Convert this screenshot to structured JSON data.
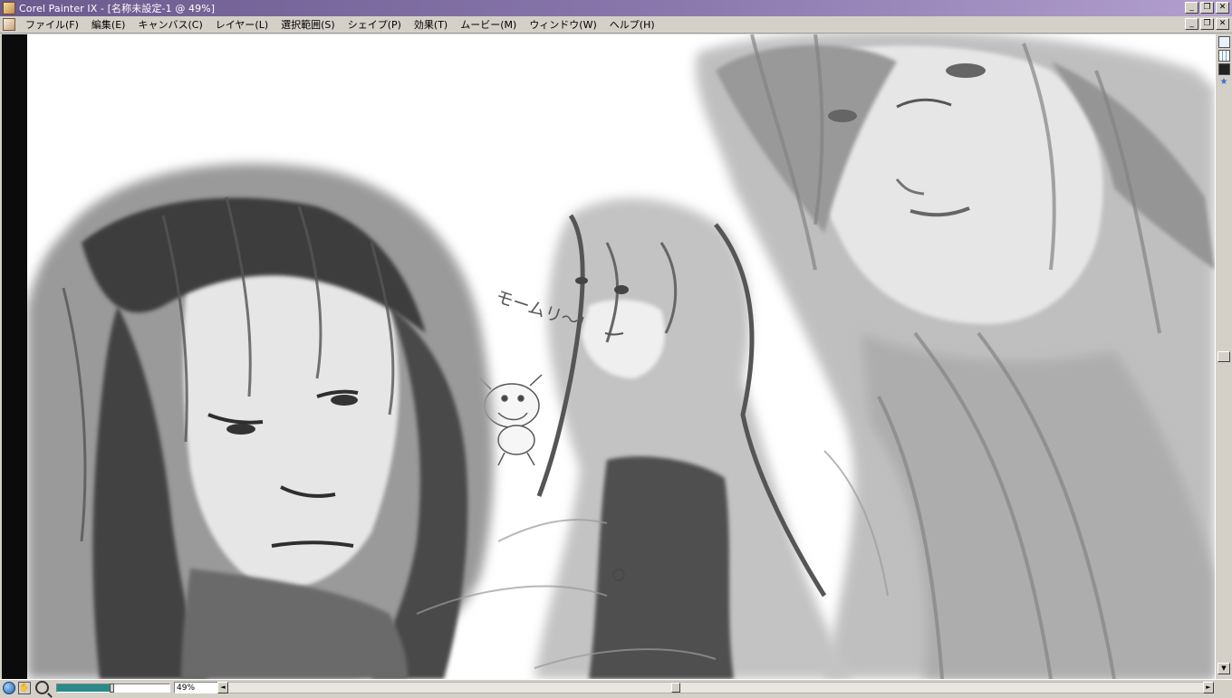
{
  "window": {
    "title": "Corel Painter IX - [名称未設定-1 @ 49%]",
    "minimize": "_",
    "restore": "❐",
    "close": "✕"
  },
  "menu": {
    "items": [
      {
        "label": "ファイル(F)"
      },
      {
        "label": "編集(E)"
      },
      {
        "label": "キャンバス(C)"
      },
      {
        "label": "レイヤー(L)"
      },
      {
        "label": "選択範囲(S)"
      },
      {
        "label": "シェイプ(P)"
      },
      {
        "label": "効果(T)"
      },
      {
        "label": "ムービー(M)"
      },
      {
        "label": "ウィンドウ(W)"
      },
      {
        "label": "ヘルプ(H)"
      }
    ]
  },
  "canvas": {
    "sketch_text": "モームリ～!"
  },
  "statusbar": {
    "zoom_text": "49%",
    "zoom_level": 0.49,
    "left_arrow": "◄",
    "right_arrow": "►"
  },
  "icons": {
    "app": "painter-icon",
    "document": "document-icon",
    "globe": "globe-icon",
    "grabber": "grabber-icon",
    "magnifier": "magnifier-icon"
  },
  "colors": {
    "titlebar_start": "#6b5a8e",
    "titlebar_end": "#b3a0cf",
    "chrome": "#d4d0c8",
    "canvas_bg": "#ffffff",
    "sketch_gray": "#8a8a8a",
    "zoom_fill": "#2a8a8a"
  }
}
